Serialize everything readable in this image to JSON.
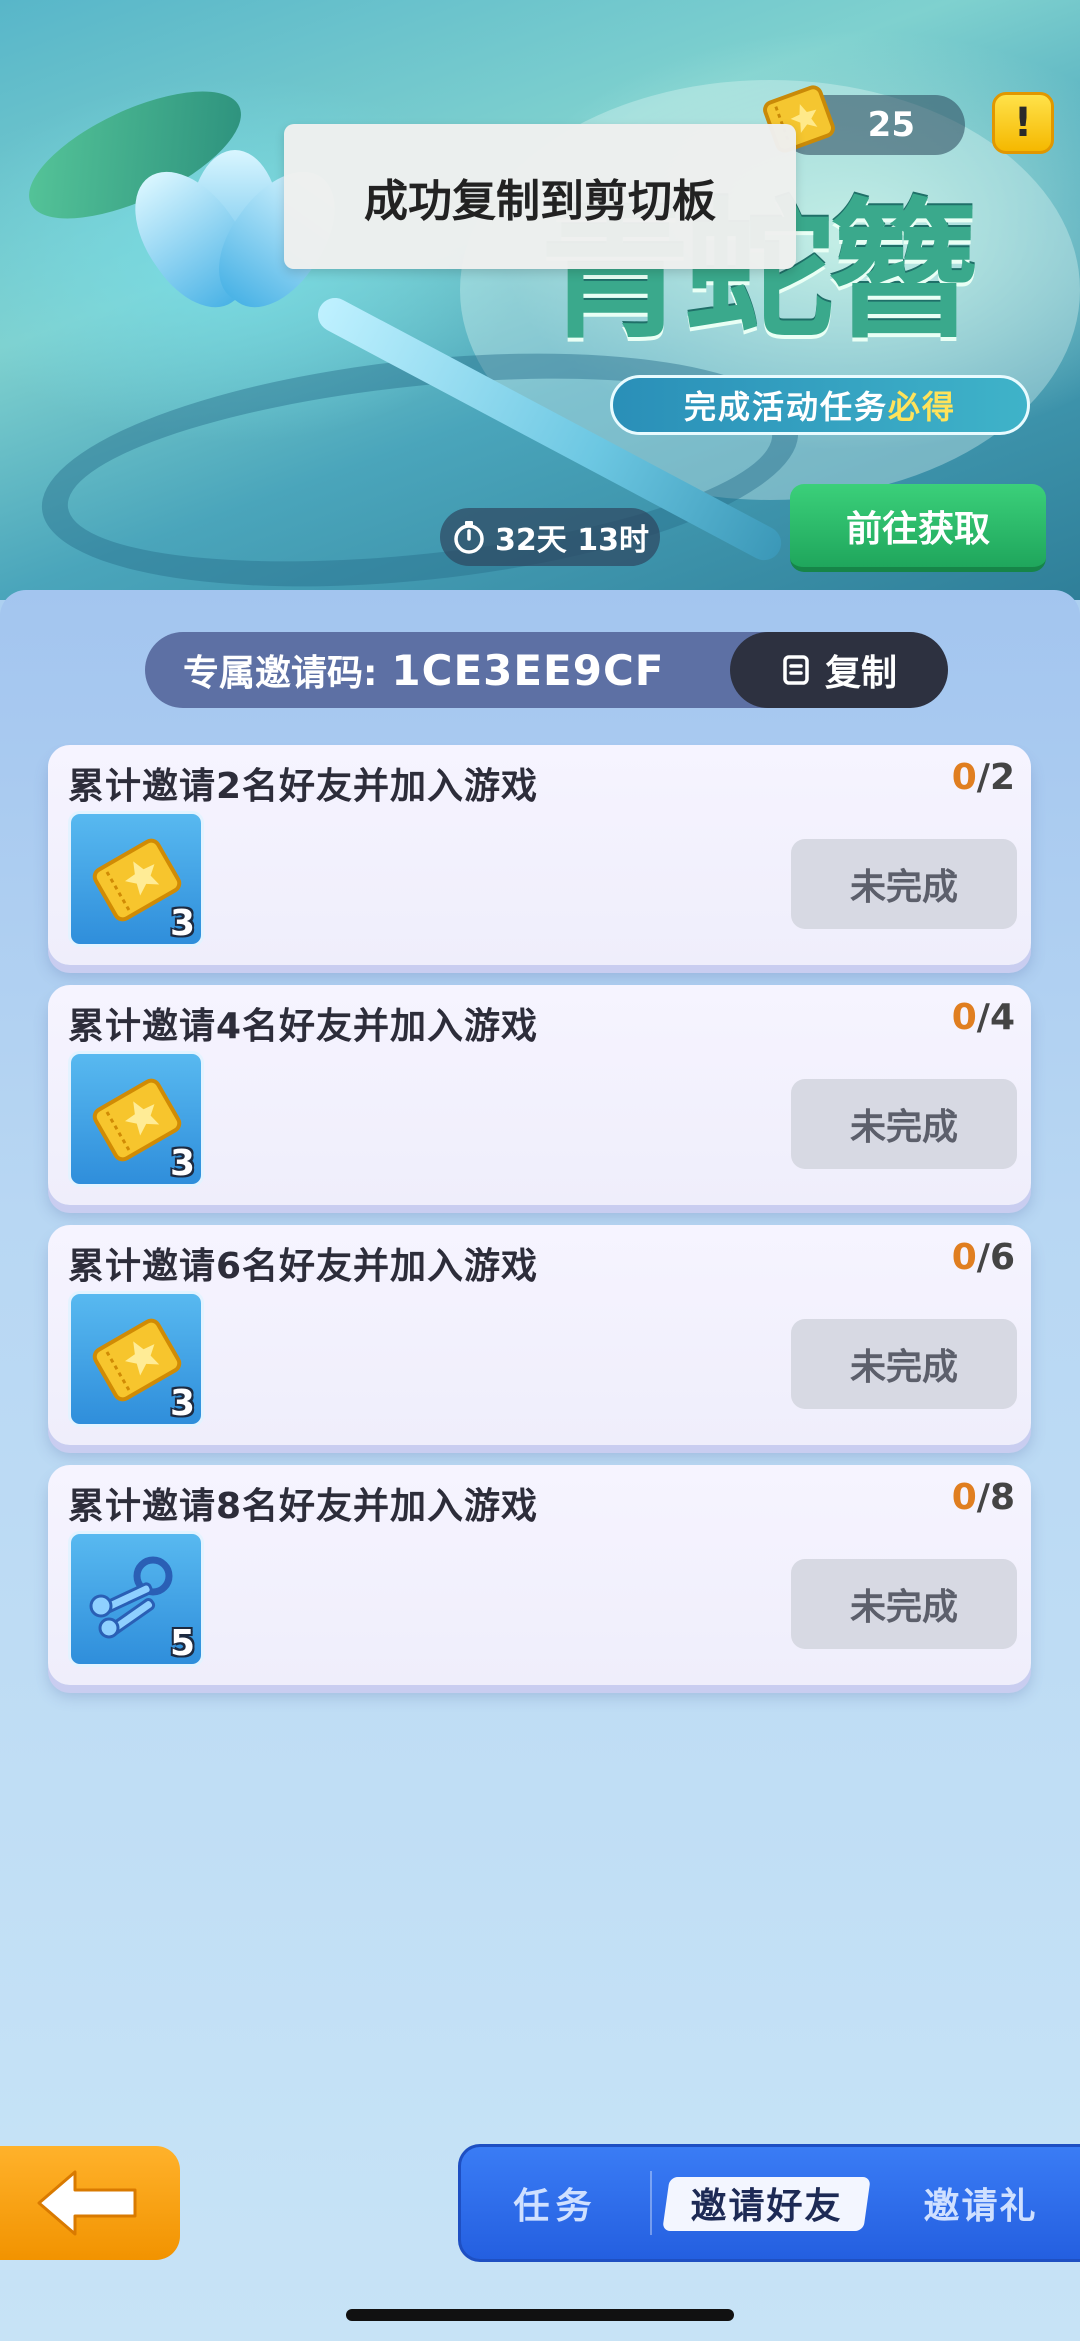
{
  "banner": {
    "title_art": "青蛇簪",
    "subtitle_prefix": "完成活动任务",
    "subtitle_highlight": "必得",
    "currency_count": "25",
    "info_label": "!",
    "timer": "32天 13时",
    "goto_label": "前往获取"
  },
  "toast": {
    "message": "成功复制到剪切板"
  },
  "invite": {
    "label": "专属邀请码:",
    "code": "1CE3EE9CF",
    "copy_label": "复制"
  },
  "tasks": [
    {
      "title": "累计邀请2名好友并加入游戏",
      "progress_current": "0",
      "progress_total": "/2",
      "reward_icon": "ticket-icon",
      "reward_count": "3",
      "status": "未完成"
    },
    {
      "title": "累计邀请4名好友并加入游戏",
      "progress_current": "0",
      "progress_total": "/4",
      "reward_icon": "ticket-icon",
      "reward_count": "3",
      "status": "未完成"
    },
    {
      "title": "累计邀请6名好友并加入游戏",
      "progress_current": "0",
      "progress_total": "/6",
      "reward_icon": "ticket-icon",
      "reward_count": "3",
      "status": "未完成"
    },
    {
      "title": "累计邀请8名好友并加入游戏",
      "progress_current": "0",
      "progress_total": "/8",
      "reward_icon": "keys-icon",
      "reward_count": "5",
      "status": "未完成"
    }
  ],
  "tabs": [
    {
      "label": "任务",
      "active": false
    },
    {
      "label": "邀请好友",
      "active": true
    },
    {
      "label": "邀请礼",
      "active": false
    }
  ],
  "colors": {
    "accent_blue": "#245fe0",
    "go_green": "#1fa65c",
    "progress_orange": "#e07e20",
    "back_orange": "#f29300"
  }
}
